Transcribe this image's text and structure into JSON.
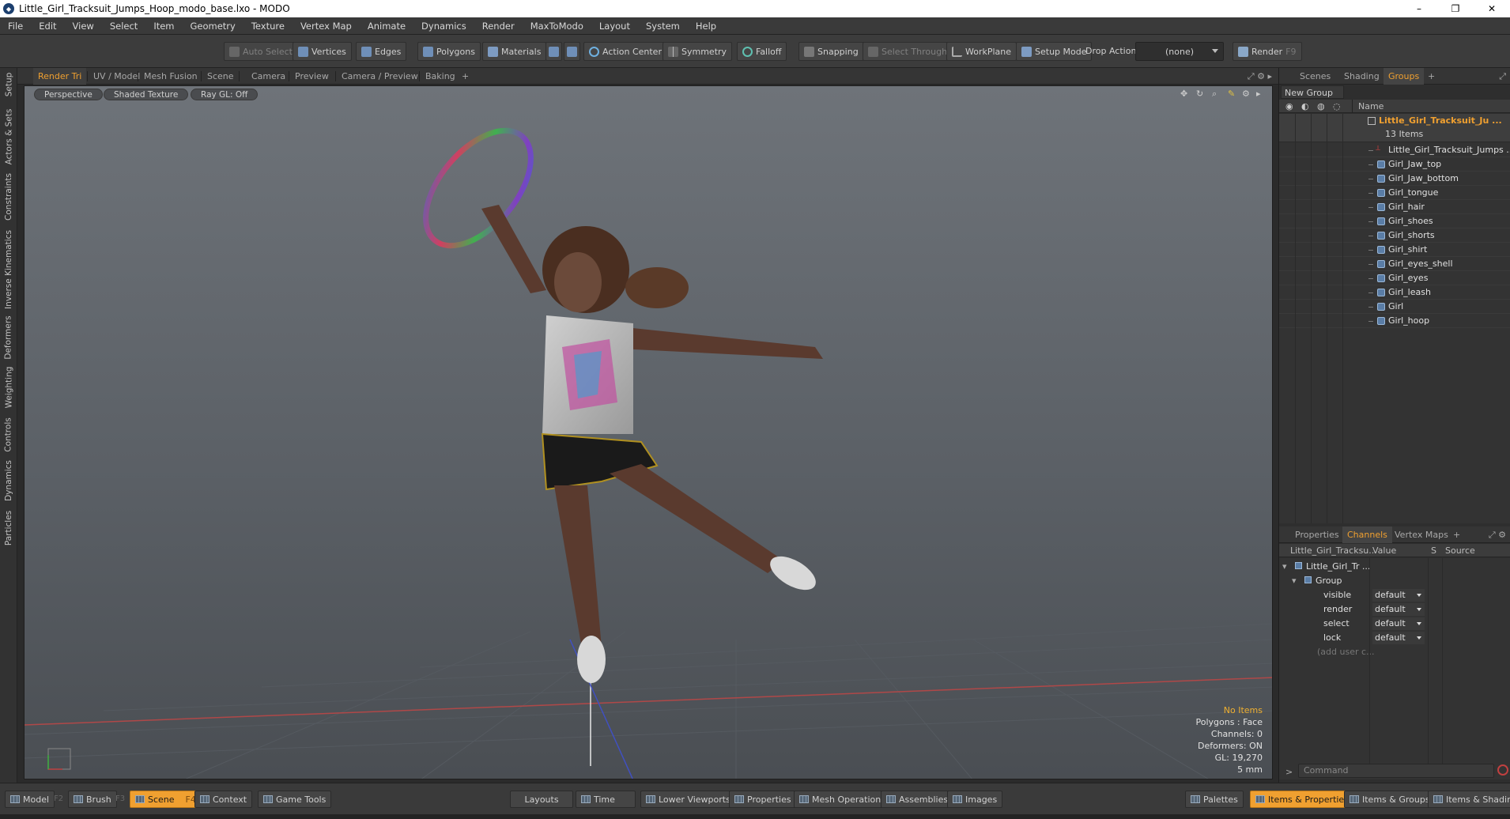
{
  "window": {
    "title": "Little_Girl_Tracksuit_Jumps_Hoop_modo_base.lxo - MODO",
    "minimize": "–",
    "restore": "❐",
    "close": "✕"
  },
  "menu": [
    "File",
    "Edit",
    "View",
    "Select",
    "Item",
    "Geometry",
    "Texture",
    "Vertex Map",
    "Animate",
    "Dynamics",
    "Render",
    "MaxToModo",
    "Layout",
    "System",
    "Help"
  ],
  "toolbar": {
    "auto_select": "Auto Select",
    "vertices": "Vertices",
    "edges": "Edges",
    "polygons": "Polygons",
    "materials": "Materials",
    "action_center": "Action Center",
    "symmetry": "Symmetry",
    "falloff": "Falloff",
    "snapping": "Snapping",
    "select_through": "Select Through",
    "workplane": "WorkPlane",
    "setup_mode": "Setup Mode",
    "drop_action_label": "Drop Action",
    "drop_action_value": "(none)",
    "render": "Render",
    "render_key": "F9"
  },
  "left_tabs": [
    "Setup",
    "Actors & Sets",
    "Constraints",
    "Inverse Kinematics",
    "Deformers",
    "Weighting",
    "Controls",
    "Dynamics",
    "Particles"
  ],
  "viewport_tabs": [
    "Render Tri",
    "UV / Model",
    "Mesh Fusion",
    "Scene",
    "Camera",
    "Preview",
    "Camera / Preview",
    "Baking",
    "+"
  ],
  "viewport": {
    "view_type": "Perspective",
    "shading": "Shaded Texture",
    "raygl": "Ray GL: Off",
    "info": {
      "selection": "No Items",
      "polygons": "Polygons : Face",
      "channels": "Channels: 0",
      "deformers": "Deformers: ON",
      "gl": "GL: 19,270",
      "unit": "5 mm"
    }
  },
  "right_panel": {
    "top_tabs": [
      "Scenes",
      "Shading",
      "Groups",
      "+"
    ],
    "new_group": "New Group",
    "name_header": "Name",
    "group": {
      "name": "Little_Girl_Tracksuit_Ju ...",
      "count": "13 Items",
      "items": [
        "Little_Girl_Tracksuit_Jumps ...",
        "Girl_Jaw_top",
        "Girl_Jaw_bottom",
        "Girl_tongue",
        "Girl_hair",
        "Girl_shoes",
        "Girl_shorts",
        "Girl_shirt",
        "Girl_eyes_shell",
        "Girl_eyes",
        "Girl_leash",
        "Girl",
        "Girl_hoop"
      ]
    },
    "bottom_tabs": [
      "Properties",
      "Channels",
      "Vertex Maps",
      "+"
    ],
    "channels": {
      "col_name": "Little_Girl_Tracksu...",
      "col_value": "Value",
      "col_s": "S",
      "col_source": "Source",
      "item": "Little_Girl_Tr ...",
      "group": "Group",
      "rows": [
        {
          "name": "visible",
          "value": "default"
        },
        {
          "name": "render",
          "value": "default"
        },
        {
          "name": "select",
          "value": "default"
        },
        {
          "name": "lock",
          "value": "default"
        }
      ],
      "add_user": "(add user c..."
    },
    "command_placeholder": "Command"
  },
  "bottom": {
    "model": "Model",
    "model_key": "F2",
    "brush": "Brush",
    "brush_key": "F3",
    "scene": "Scene",
    "scene_key": "F4",
    "context": "Context",
    "game_tools": "Game Tools",
    "layouts": "Layouts",
    "time": "Time",
    "lower_viewports": "Lower Viewports",
    "properties": "Properties",
    "mesh_operations": "Mesh Operations",
    "assemblies": "Assemblies",
    "images": "Images",
    "palettes": "Palettes",
    "items_properties": "Items & Properties",
    "items_groups": "Items & Groups",
    "items_shading": "Items & Shading"
  },
  "colors": {
    "accent": "#f0a030",
    "panel": "#2e2e2e",
    "viewport_top": "#6e7379"
  }
}
